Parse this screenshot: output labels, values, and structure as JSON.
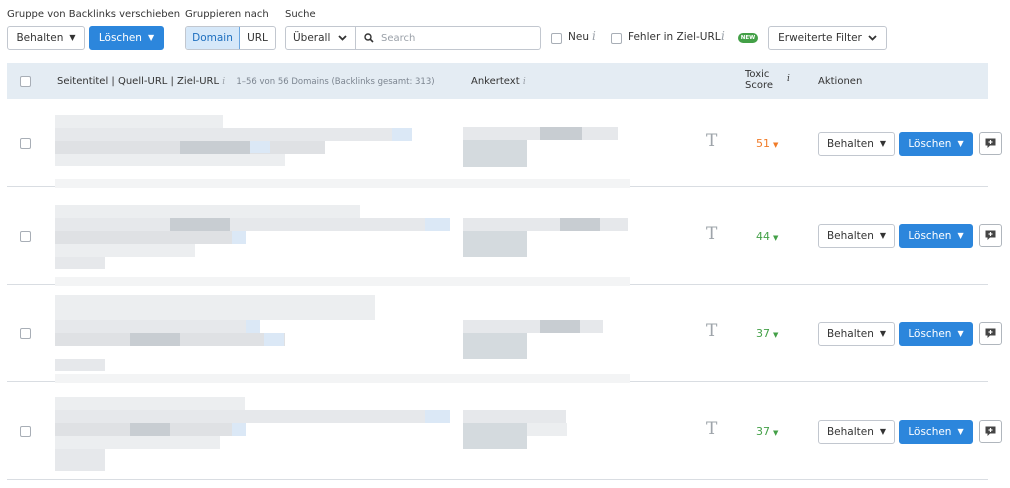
{
  "toolbar": {
    "move_group_label": "Gruppe von Backlinks verschieben",
    "group_by_label": "Gruppieren nach",
    "search_label": "Suche",
    "keep_label": "Behalten",
    "delete_label": "Löschen",
    "group_options": [
      "Domain",
      "URL"
    ],
    "group_selected": "Domain",
    "search_scope": "Überall",
    "search_placeholder": "Search",
    "filter_new_label": "Neu",
    "filter_target_error_label": "Fehler in Ziel-URL",
    "new_badge": "NEW",
    "advanced_filters_label": "Erweiterte Filter"
  },
  "table": {
    "col_title": "Seitentitel | Quell-URL | Ziel-URL",
    "col_title_count": "1–56 von 56 Domains (Backlinks gesamt: 313)",
    "col_anchor": "Ankertext",
    "col_toxic_line1": "Toxic",
    "col_toxic_line2": "Score",
    "col_actions": "Aktionen",
    "text_type_glyph": "T",
    "rows": [
      {
        "score": "51",
        "score_color": "#f07b28"
      },
      {
        "score": "44",
        "score_color": "#43a047"
      },
      {
        "score": "37",
        "score_color": "#43a047"
      },
      {
        "score": "37",
        "score_color": "#43a047"
      }
    ]
  },
  "icons": {
    "search": "search-icon",
    "chevron": "chevron-down-icon",
    "info": "info-icon",
    "comment": "comment-icon",
    "text_type": "text-type-icon"
  },
  "colors": {
    "primary": "#2c86dc",
    "header_bg": "#e4ecf3",
    "score_high": "#f07b28",
    "score_mid": "#43a047",
    "new_badge": "#43a047"
  }
}
